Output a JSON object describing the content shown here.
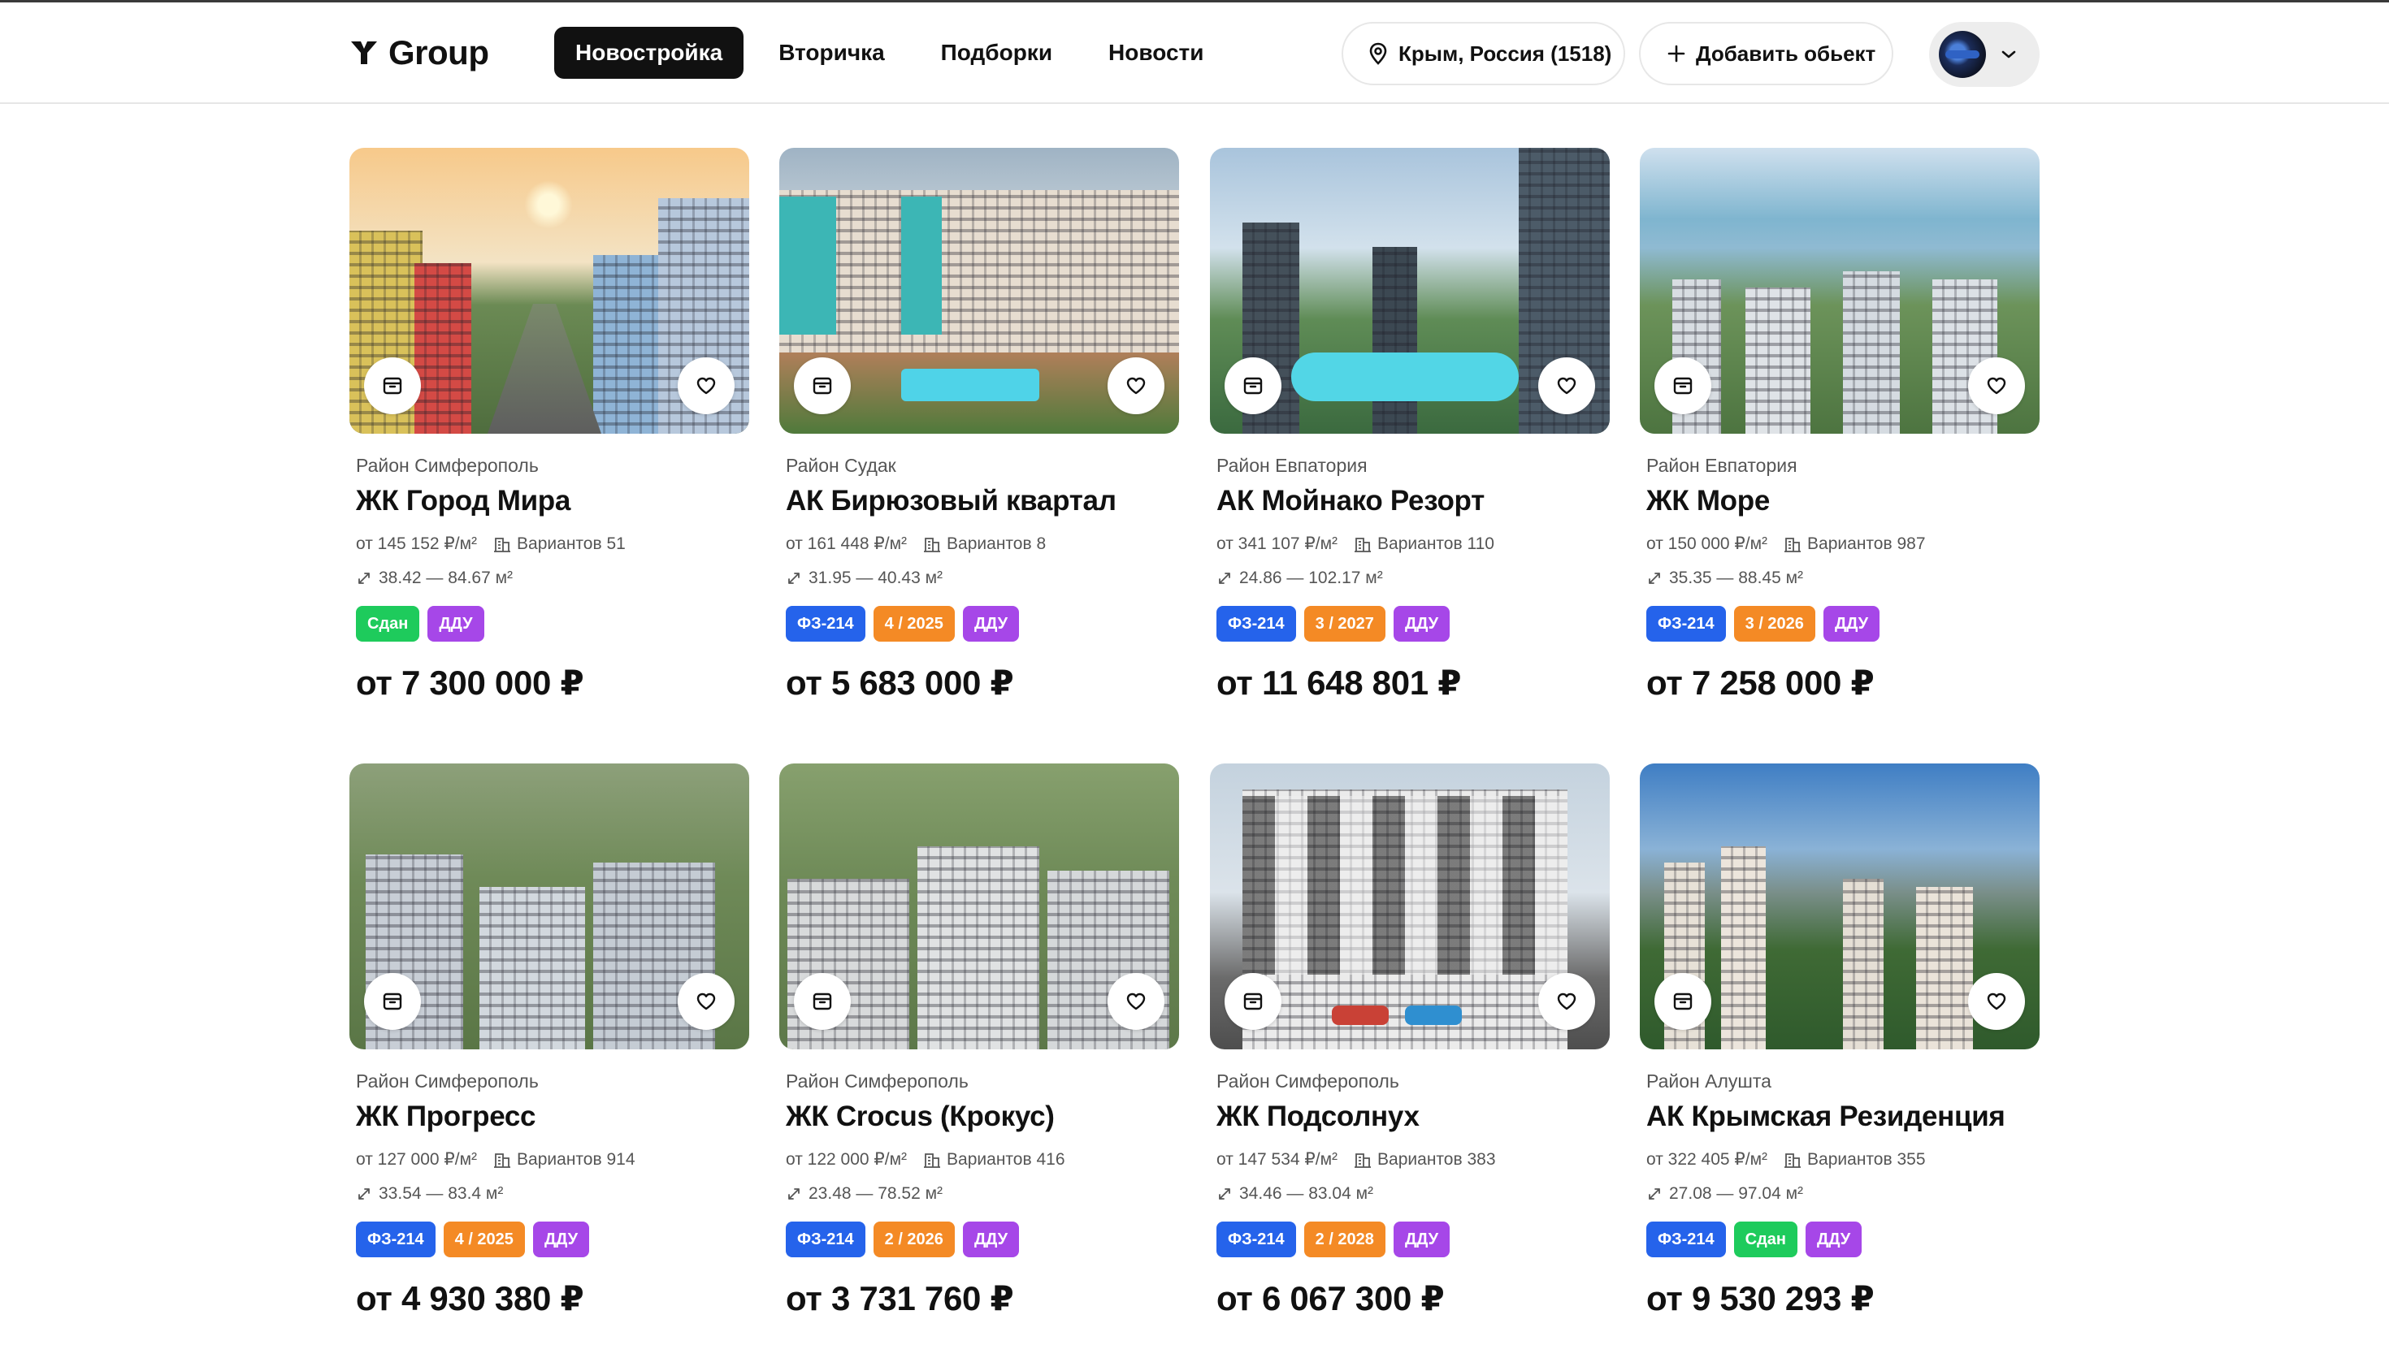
{
  "colors": {
    "nav_active_bg": "#111111",
    "badge_fz": "#2563eb",
    "badge_date": "#f48a25",
    "badge_ddu": "#a647e8",
    "badge_done": "#1ecb5c"
  },
  "header": {
    "logo_text": "Group",
    "nav": [
      {
        "label": "Новостройка",
        "active": true
      },
      {
        "label": "Вторичка",
        "active": false
      },
      {
        "label": "Подборки",
        "active": false
      },
      {
        "label": "Новости",
        "active": false
      }
    ],
    "region_label": "Крым, Россия (1518)",
    "add_label": "Добавить обьект",
    "icons": {
      "region": "location-pin-icon",
      "add": "plus-icon",
      "profile_menu": "chevron-down-icon"
    }
  },
  "cards": [
    {
      "district": "Район Симферополь",
      "title": "ЖК Город Мира",
      "price_m2": "от 145 152 ₽/м²",
      "variants": "Вариантов 51",
      "area": "38.42 — 84.67 м²",
      "badges": [
        {
          "text": "Сдан",
          "kind": "done"
        },
        {
          "text": "ДДУ",
          "kind": "ddu"
        }
      ],
      "price": "от 7 300 000 ₽"
    },
    {
      "district": "Район Судак",
      "title": "АК Бирюзовый квартал",
      "price_m2": "от 161 448 ₽/м²",
      "variants": "Вариантов 8",
      "area": "31.95 — 40.43 м²",
      "badges": [
        {
          "text": "ФЗ-214",
          "kind": "fz"
        },
        {
          "text": "4 / 2025",
          "kind": "date"
        },
        {
          "text": "ДДУ",
          "kind": "ddu"
        }
      ],
      "price": "от 5 683 000 ₽"
    },
    {
      "district": "Район Евпатория",
      "title": "АК Мойнако Резорт",
      "price_m2": "от 341 107 ₽/м²",
      "variants": "Вариантов 110",
      "area": "24.86 — 102.17 м²",
      "badges": [
        {
          "text": "ФЗ-214",
          "kind": "fz"
        },
        {
          "text": "3 / 2027",
          "kind": "date"
        },
        {
          "text": "ДДУ",
          "kind": "ddu"
        }
      ],
      "price": "от 11 648 801 ₽"
    },
    {
      "district": "Район Евпатория",
      "title": "ЖК Море",
      "price_m2": "от 150 000 ₽/м²",
      "variants": "Вариантов 987",
      "area": "35.35 — 88.45 м²",
      "badges": [
        {
          "text": "ФЗ-214",
          "kind": "fz"
        },
        {
          "text": "3 / 2026",
          "kind": "date"
        },
        {
          "text": "ДДУ",
          "kind": "ddu"
        }
      ],
      "price": "от 7 258 000 ₽"
    },
    {
      "district": "Район Симферополь",
      "title": "ЖК Прогресс",
      "price_m2": "от 127 000 ₽/м²",
      "variants": "Вариантов 914",
      "area": "33.54 — 83.4 м²",
      "badges": [
        {
          "text": "ФЗ-214",
          "kind": "fz"
        },
        {
          "text": "4 / 2025",
          "kind": "date"
        },
        {
          "text": "ДДУ",
          "kind": "ddu"
        }
      ],
      "price": "от 4 930 380 ₽"
    },
    {
      "district": "Район Симферополь",
      "title": "ЖК Crocus (Крокус)",
      "price_m2": "от 122 000 ₽/м²",
      "variants": "Вариантов 416",
      "area": "23.48 — 78.52 м²",
      "badges": [
        {
          "text": "ФЗ-214",
          "kind": "fz"
        },
        {
          "text": "2 / 2026",
          "kind": "date"
        },
        {
          "text": "ДДУ",
          "kind": "ddu"
        }
      ],
      "price": "от 3 731 760 ₽"
    },
    {
      "district": "Район Симферополь",
      "title": "ЖК Подсолнух",
      "price_m2": "от 147 534 ₽/м²",
      "variants": "Вариантов 383",
      "area": "34.46 — 83.04 м²",
      "badges": [
        {
          "text": "ФЗ-214",
          "kind": "fz"
        },
        {
          "text": "2 / 2028",
          "kind": "date"
        },
        {
          "text": "ДДУ",
          "kind": "ddu"
        }
      ],
      "price": "от 6 067 300 ₽"
    },
    {
      "district": "Район Алушта",
      "title": "АК Крымская Резиденция",
      "price_m2": "от 322 405 ₽/м²",
      "variants": "Вариантов 355",
      "area": "27.08 — 97.04 м²",
      "badges": [
        {
          "text": "ФЗ-214",
          "kind": "fz"
        },
        {
          "text": "Сдан",
          "kind": "done"
        },
        {
          "text": "ДДУ",
          "kind": "ddu"
        }
      ],
      "price": "от 9 530 293 ₽"
    }
  ]
}
